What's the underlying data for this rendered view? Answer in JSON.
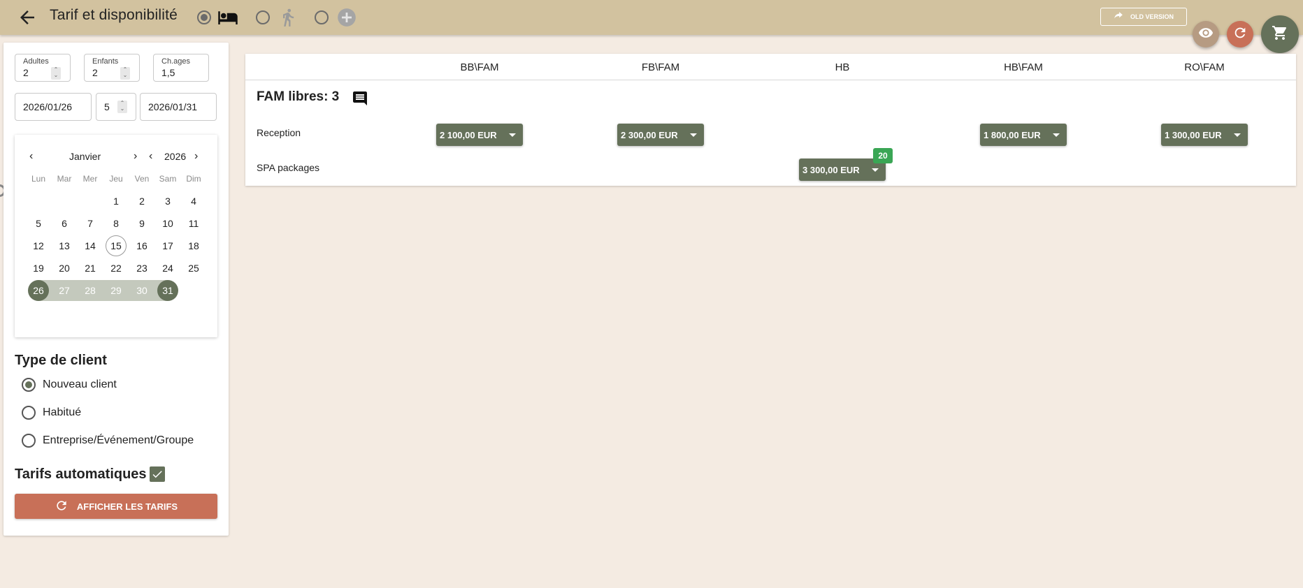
{
  "header": {
    "title": "Tarif et disponibilité",
    "modes": [
      {
        "icon": "bed-icon",
        "selected": true
      },
      {
        "icon": "walk-icon",
        "selected": false
      },
      {
        "icon": "add-circle-icon",
        "selected": false
      }
    ],
    "old_version_label": "OLD VERSION",
    "colors": {
      "bar": "#d2c29f",
      "view": "#b69b82",
      "refresh": "#c87058",
      "cart": "#65715a"
    }
  },
  "search": {
    "adults_label": "Adultes",
    "adults_value": "2",
    "children_label": "Enfants",
    "children_value": "2",
    "ages_label": "Ch.ages",
    "ages_value": "1,5",
    "start_date": "2026/01/26",
    "nights": "5",
    "end_date": "2026/01/31"
  },
  "calendar": {
    "month": "Janvier",
    "year": "2026",
    "weekdays": [
      "Lun",
      "Mar",
      "Mer",
      "Jeu",
      "Ven",
      "Sam",
      "Dim"
    ],
    "weeks": [
      [
        "",
        "",
        "",
        "1",
        "2",
        "3",
        "4"
      ],
      [
        "5",
        "6",
        "7",
        "8",
        "9",
        "10",
        "11"
      ],
      [
        "12",
        "13",
        "14",
        "15",
        "16",
        "17",
        "18"
      ],
      [
        "19",
        "20",
        "21",
        "22",
        "23",
        "24",
        "25"
      ],
      [
        "26",
        "27",
        "28",
        "29",
        "30",
        "31",
        ""
      ]
    ],
    "today": "15",
    "range_start": "26",
    "range_end": "31"
  },
  "client_type": {
    "title": "Type de client",
    "options": [
      "Nouveau client",
      "Habitué",
      "Entreprise/Événement/Groupe"
    ],
    "selected": 0
  },
  "auto_rates": {
    "label": "Tarifs automatiques",
    "checked": true
  },
  "show_rates_button": "AFFICHER LES TARIFS",
  "rates": {
    "columns": [
      "BB\\FAM",
      "FB\\FAM",
      "HB",
      "HB\\FAM",
      "RO\\FAM"
    ],
    "availability": "FAM libres: 3",
    "rows": [
      {
        "label": "Reception",
        "prices": [
          "2 100,00 EUR",
          "2 300,00 EUR",
          "",
          "1 800,00 EUR",
          "1 300,00 EUR"
        ]
      },
      {
        "label": "SPA packages",
        "prices": [
          "",
          "",
          "3 300,00 EUR",
          "",
          ""
        ],
        "badge": "20"
      }
    ]
  }
}
